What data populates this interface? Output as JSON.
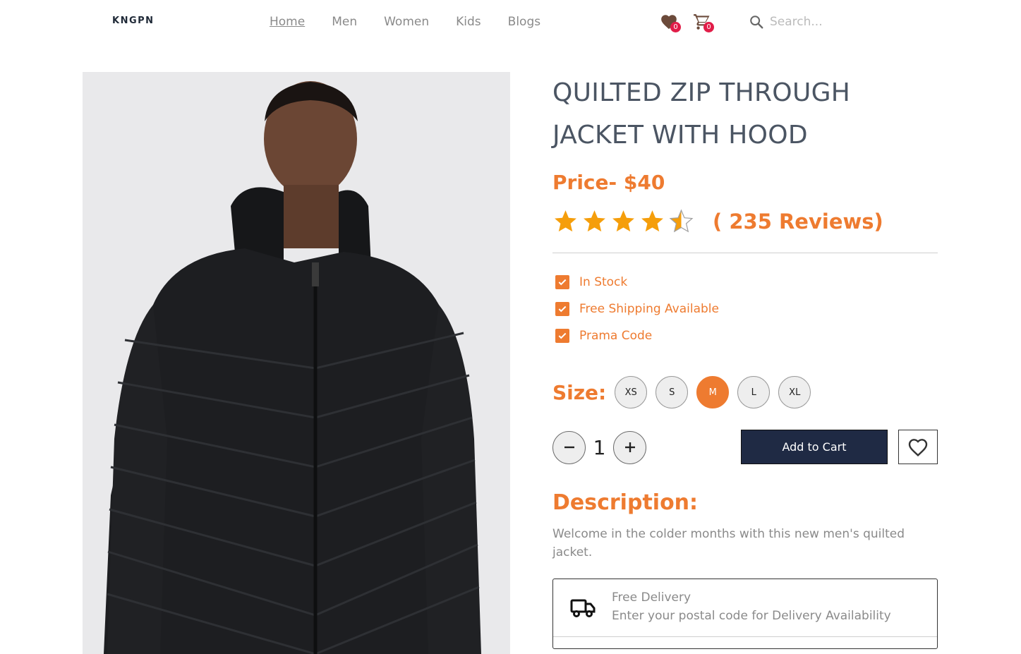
{
  "header": {
    "logo": "KNGPN",
    "nav": [
      {
        "label": "Home",
        "active": true
      },
      {
        "label": "Men",
        "active": false
      },
      {
        "label": "Women",
        "active": false
      },
      {
        "label": "Kids",
        "active": false
      },
      {
        "label": "Blogs",
        "active": false
      }
    ],
    "wishlist_count": "0",
    "cart_count": "0",
    "search_placeholder": "Search..."
  },
  "product": {
    "image_icon": "jacket-photo",
    "title_line1": "QUILTED ZIP THROUGH",
    "title_line2": "JACKET WITH HOOD",
    "price": "Price- $40",
    "rating": 4.5,
    "reviews": "( 235 Reviews)",
    "features": [
      "In Stock",
      "Free Shipping Available",
      "Prama Code"
    ],
    "size_label": "Size:",
    "sizes": [
      "XS",
      "S",
      "M",
      "L",
      "XL"
    ],
    "selected_size": "M",
    "quantity": "1",
    "add_to_cart": "Add to Cart",
    "description_title": "Description:",
    "description": "Welcome in the colder months with this new men's quilted jacket.",
    "delivery_title": "Free Delivery",
    "delivery_sub": "Enter your postal code for Delivery Availability"
  },
  "colors": {
    "accent": "#ee7b30",
    "navy": "#1f2a44",
    "star": "#f59e0b",
    "badge": "#e11d48"
  }
}
